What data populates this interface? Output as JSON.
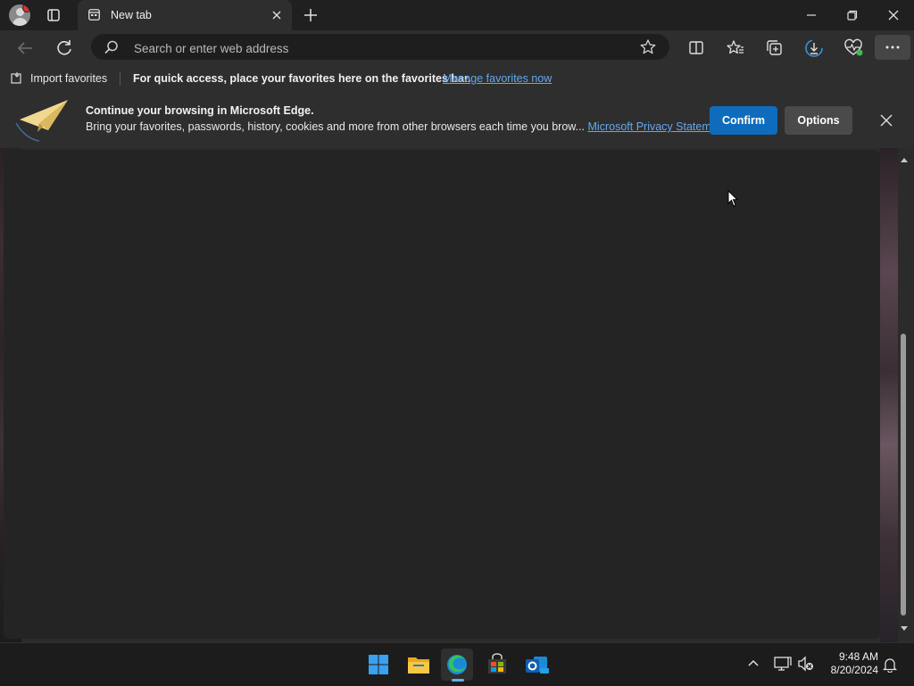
{
  "tab": {
    "title": "New tab"
  },
  "addressbar": {
    "placeholder": "Search or enter web address"
  },
  "favorites_bar": {
    "import_label": "Import favorites",
    "message": "For quick access, place your favorites here on the favorites bar.",
    "manage_link": "Manage favorites now"
  },
  "banner": {
    "title": "Continue your browsing in Microsoft Edge.",
    "description": "Bring your favorites, passwords, history, cookies and more from other browsers each time you brow...",
    "privacy_link": "Microsoft Privacy Statement",
    "confirm_label": "Confirm",
    "options_label": "Options"
  },
  "taskbar": {
    "time": "9:48 AM",
    "date": "8/20/2024",
    "apps": [
      "start-icon",
      "file-explorer-icon",
      "edge-icon",
      "store-icon",
      "outlook-icon"
    ]
  },
  "colors": {
    "accent": "#0f6cbd",
    "link": "#63a8f0",
    "background": "#202020"
  }
}
